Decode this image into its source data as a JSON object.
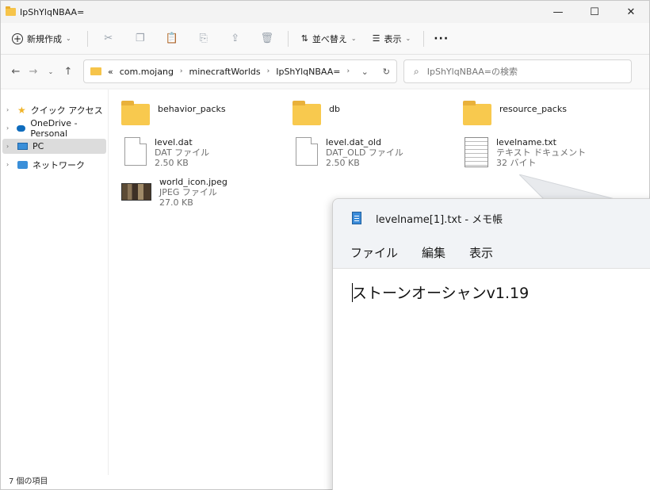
{
  "explorer": {
    "window_title": "IpShYlqNBAA=",
    "controls": {
      "minimize": "—",
      "maximize": "☐",
      "close": "✕"
    },
    "toolbar": {
      "new_label": "新規作成",
      "sort_label": "並べ替え",
      "view_label": "表示",
      "more_label": "···"
    },
    "address": {
      "overflow": "«",
      "crumbs": [
        "com.mojang",
        "minecraftWorlds",
        "IpShYlqNBAA="
      ]
    },
    "search": {
      "placeholder": "IpShYlqNBAA=の検索"
    },
    "nav": {
      "items": [
        {
          "label": "クイック アクセス"
        },
        {
          "label": "OneDrive - Personal"
        },
        {
          "label": "PC"
        },
        {
          "label": "ネットワーク"
        }
      ]
    },
    "files": [
      {
        "name": "behavior_packs",
        "kind": "folder"
      },
      {
        "name": "db",
        "kind": "folder"
      },
      {
        "name": "resource_packs",
        "kind": "folder"
      },
      {
        "name": "level.dat",
        "type": "DAT ファイル",
        "size": "2.50 KB"
      },
      {
        "name": "level.dat_old",
        "type": "DAT_OLD ファイル",
        "size": "2.50 KB"
      },
      {
        "name": "levelname.txt",
        "type": "テキスト ドキュメント",
        "size": "32 バイト"
      },
      {
        "name": "world_icon.jpeg",
        "type": "JPEG ファイル",
        "size": "27.0 KB"
      }
    ],
    "status": "7 個の項目"
  },
  "notepad": {
    "title": "levelname[1].txt - メモ帳",
    "menu": [
      "ファイル",
      "編集",
      "表示"
    ],
    "content": "ストーンオーシャンv1.19"
  }
}
